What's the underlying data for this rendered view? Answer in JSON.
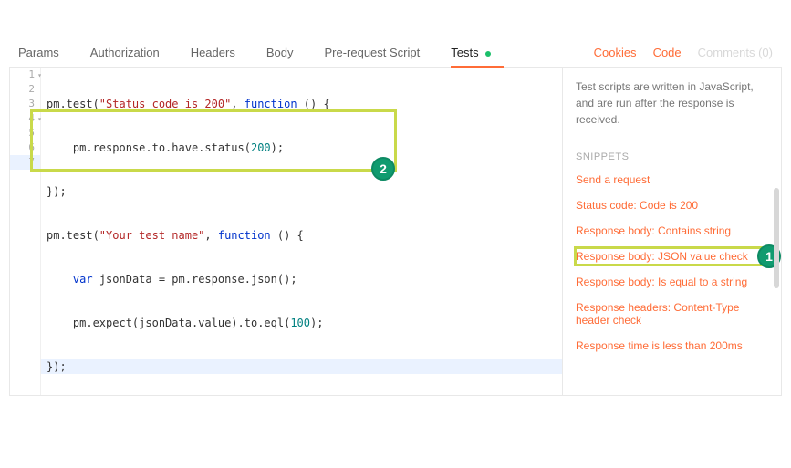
{
  "tabs": {
    "params": "Params",
    "authorization": "Authorization",
    "headers": "Headers",
    "body": "Body",
    "preRequest": "Pre-request Script",
    "tests": "Tests"
  },
  "rightLinks": {
    "cookies": "Cookies",
    "code": "Code",
    "comments": "Comments (0)"
  },
  "code": {
    "lines": [
      {
        "n": "1",
        "fold": true
      },
      {
        "n": "2"
      },
      {
        "n": "3"
      },
      {
        "n": "4",
        "fold": true
      },
      {
        "n": "5"
      },
      {
        "n": "6"
      },
      {
        "n": "7"
      }
    ],
    "l1a": "pm.test(",
    "l1s": "\"Status code is 200\"",
    "l1b": ", ",
    "l1k": "function",
    "l1c": " () {",
    "l2a": "    pm.response.to.have.status(",
    "l2n": "200",
    "l2b": ");",
    "l3": "});",
    "l4a": "pm.test(",
    "l4s": "\"Your test name\"",
    "l4b": ", ",
    "l4k": "function",
    "l4c": " () {",
    "l5a": "    ",
    "l5k": "var",
    "l5b": " jsonData = pm.response.json();",
    "l6a": "    pm.expect(jsonData.value).to.eql(",
    "l6n": "100",
    "l6b": ");",
    "l7": "});"
  },
  "side": {
    "desc": "Test scripts are written in JavaScript, and are run after the response is received.",
    "heading": "SNIPPETS",
    "snippets": {
      "s1": "Send a request",
      "s2": "Status code: Code is 200",
      "s3": "Response body: Contains string",
      "s4": "Response body: JSON value check",
      "s5": "Response body: Is equal to a string",
      "s6": "Response headers: Content-Type header check",
      "s7": "Response time is less than 200ms"
    }
  },
  "badges": {
    "one": "1",
    "two": "2"
  }
}
